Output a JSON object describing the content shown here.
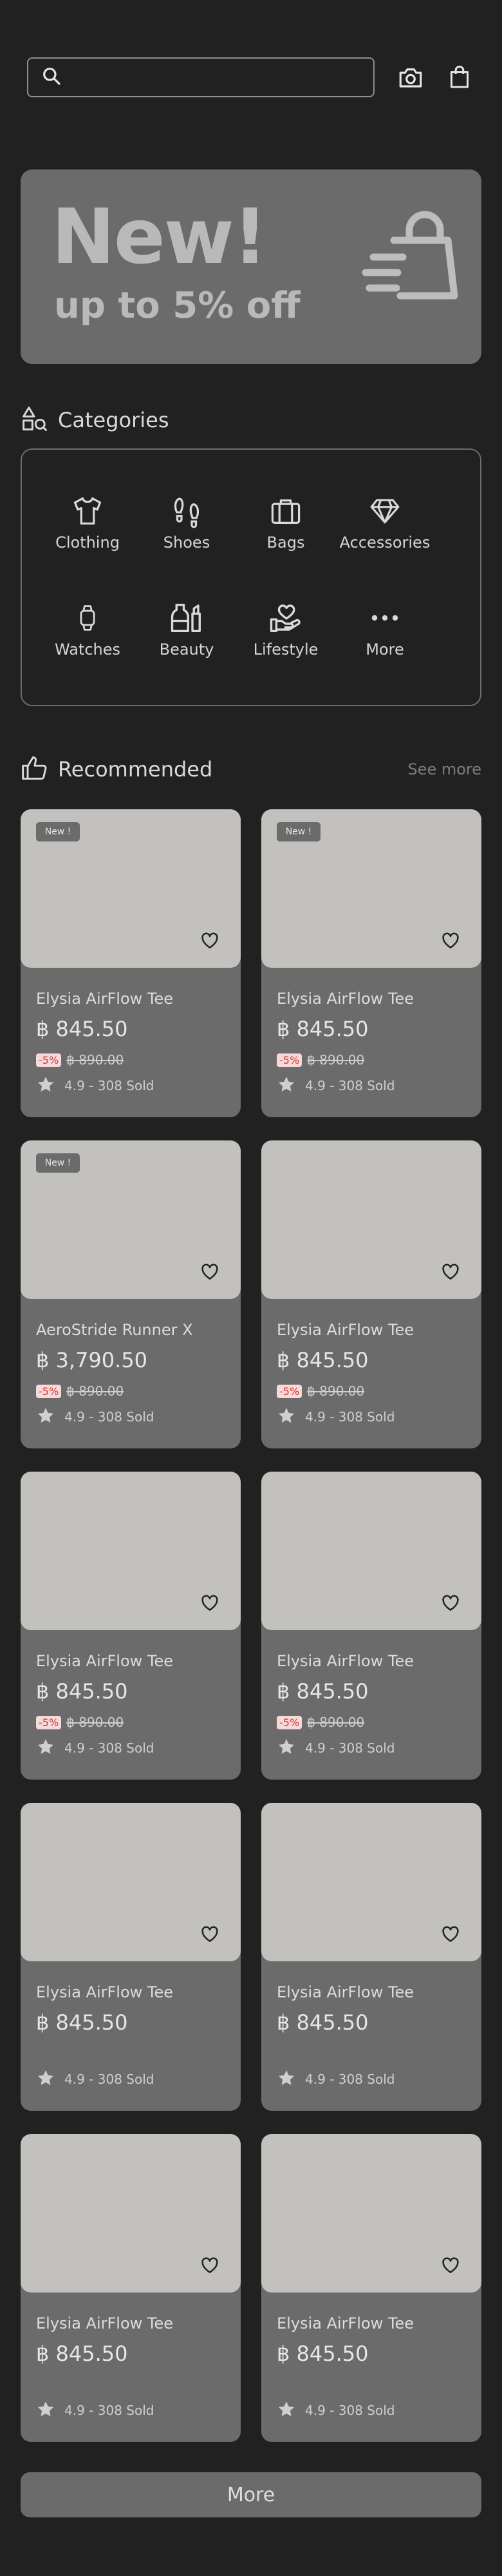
{
  "search": {
    "placeholder": "",
    "value": ""
  },
  "banner": {
    "title": "New!",
    "subtitle": "up to 5% off"
  },
  "categories": {
    "title": "Categories",
    "items": [
      {
        "label": "Clothing",
        "icon": "shirt-icon"
      },
      {
        "label": "Shoes",
        "icon": "footprints-icon"
      },
      {
        "label": "Bags",
        "icon": "briefcase-icon"
      },
      {
        "label": "Accessories",
        "icon": "diamond-icon"
      },
      {
        "label": "Watches",
        "icon": "watch-icon"
      },
      {
        "label": "Beauty",
        "icon": "cosmetics-icon"
      },
      {
        "label": "Lifestyle",
        "icon": "hand-heart-icon"
      },
      {
        "label": "More",
        "icon": "more-dots-icon"
      }
    ]
  },
  "recommended": {
    "title": "Recommended",
    "see_more": "See more",
    "products": [
      {
        "name": "Elysia AirFlow Tee",
        "price": "฿ 845.50",
        "badge": "New !",
        "discount": "-5%",
        "old_price": "฿ 890.00",
        "rating": "4.9 - 308 Sold"
      },
      {
        "name": "Elysia AirFlow Tee",
        "price": "฿ 845.50",
        "badge": "New !",
        "discount": "-5%",
        "old_price": "฿ 890.00",
        "rating": "4.9 - 308 Sold"
      },
      {
        "name": "AeroStride Runner X",
        "price": "฿ 3,790.50",
        "badge": "New !",
        "discount": "-5%",
        "old_price": "฿ 890.00",
        "rating": "4.9 - 308 Sold"
      },
      {
        "name": "Elysia AirFlow Tee",
        "price": "฿ 845.50",
        "badge": "",
        "discount": "-5%",
        "old_price": "฿ 890.00",
        "rating": "4.9 - 308 Sold"
      },
      {
        "name": "Elysia AirFlow Tee",
        "price": "฿ 845.50",
        "badge": "",
        "discount": "-5%",
        "old_price": "฿ 890.00",
        "rating": "4.9 - 308 Sold"
      },
      {
        "name": "Elysia AirFlow Tee",
        "price": "฿ 845.50",
        "badge": "",
        "discount": "-5%",
        "old_price": "฿ 890.00",
        "rating": "4.9 - 308 Sold"
      },
      {
        "name": "Elysia AirFlow Tee",
        "price": "฿ 845.50",
        "badge": "",
        "discount": "",
        "old_price": "",
        "rating": "4.9 - 308 Sold"
      },
      {
        "name": "Elysia AirFlow Tee",
        "price": "฿ 845.50",
        "badge": "",
        "discount": "",
        "old_price": "",
        "rating": "4.9 - 308 Sold"
      },
      {
        "name": "Elysia AirFlow Tee",
        "price": "฿ 845.50",
        "badge": "",
        "discount": "",
        "old_price": "",
        "rating": "4.9 - 308 Sold"
      },
      {
        "name": "Elysia AirFlow Tee",
        "price": "฿ 845.50",
        "badge": "",
        "discount": "",
        "old_price": "",
        "rating": "4.9 - 308 Sold"
      }
    ]
  },
  "more_button": "More",
  "colors": {
    "background": "#212121",
    "card": "#6b6b6b",
    "image_placeholder": "#c2c1bd",
    "discount_text": "#d23b3b",
    "discount_bg": "#f7d9d9"
  }
}
